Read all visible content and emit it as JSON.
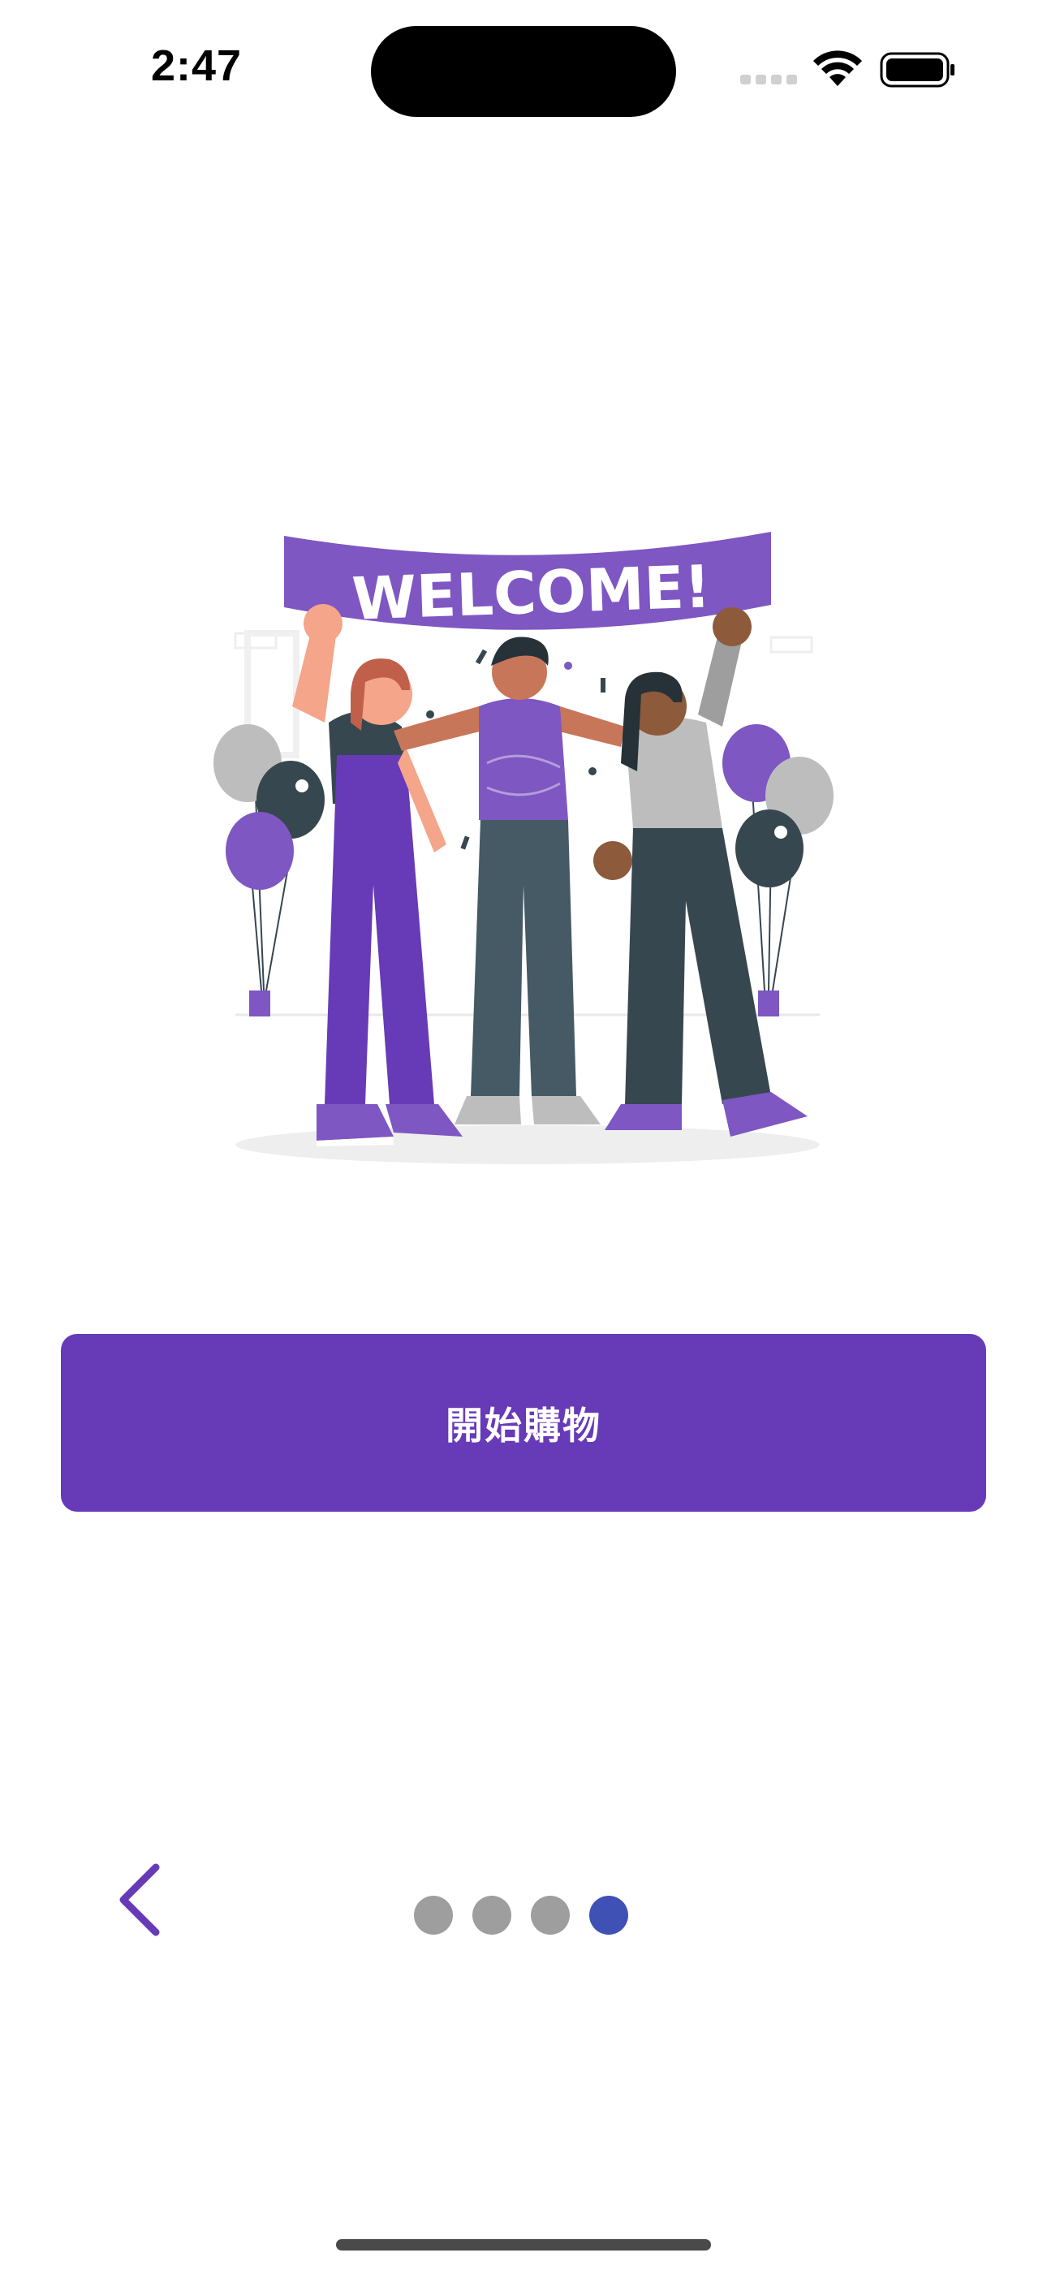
{
  "status_bar": {
    "time": "2:47"
  },
  "illustration": {
    "banner_text": "WELCOME!",
    "colors": {
      "purple": "#7e57c2",
      "dark": "#37474f",
      "gray": "#bdbdbd"
    }
  },
  "cta": {
    "label": "開始購物",
    "background": "#673ab7"
  },
  "pagination": {
    "total": 4,
    "active_index": 3,
    "inactive_color": "#9e9e9e",
    "active_color": "#3f51b5"
  },
  "icons": {
    "back": "chevron-left-icon",
    "signal": "cellular-signal-icon",
    "wifi": "wifi-icon",
    "battery": "battery-icon"
  }
}
